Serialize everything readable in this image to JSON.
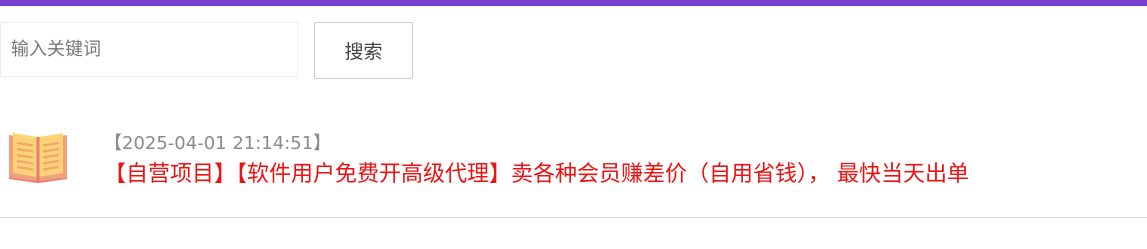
{
  "header": {
    "accent_color": "#7b3fd1"
  },
  "search": {
    "placeholder": "输入关键词",
    "value": "",
    "button_label": "搜索"
  },
  "list": {
    "items": [
      {
        "icon": "open-book-icon",
        "timestamp": "【2025-04-01 21:14:51】",
        "title": "【自营项目】【软件用户免费开高级代理】卖各种会员赚差价（自用省钱），  最快当天出单",
        "title_color": "#ee1111"
      }
    ]
  }
}
